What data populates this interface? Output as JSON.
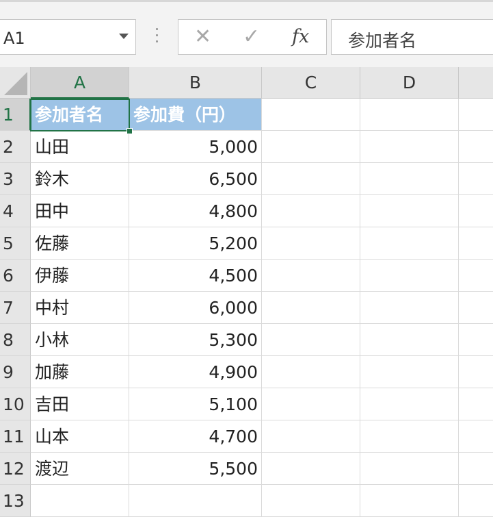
{
  "name_box": {
    "value": "A1"
  },
  "formula_bar": {
    "content": "参加者名"
  },
  "columns": [
    "A",
    "B",
    "C",
    "D"
  ],
  "rows": [
    "1",
    "2",
    "3",
    "4",
    "5",
    "6",
    "7",
    "8",
    "9",
    "10",
    "11",
    "12",
    "13"
  ],
  "sheet": {
    "header": [
      "参加者名",
      "参加費（円）"
    ],
    "data": [
      [
        "山田",
        "5,000"
      ],
      [
        "鈴木",
        "6,500"
      ],
      [
        "田中",
        "4,800"
      ],
      [
        "佐藤",
        "5,200"
      ],
      [
        "伊藤",
        "4,500"
      ],
      [
        "中村",
        "6,000"
      ],
      [
        "小林",
        "5,300"
      ],
      [
        "加藤",
        "4,900"
      ],
      [
        "吉田",
        "5,100"
      ],
      [
        "山本",
        "4,700"
      ],
      [
        "渡辺",
        "5,500"
      ]
    ]
  },
  "colors": {
    "header_fill": "#9dc3e6",
    "selection": "#217346"
  }
}
